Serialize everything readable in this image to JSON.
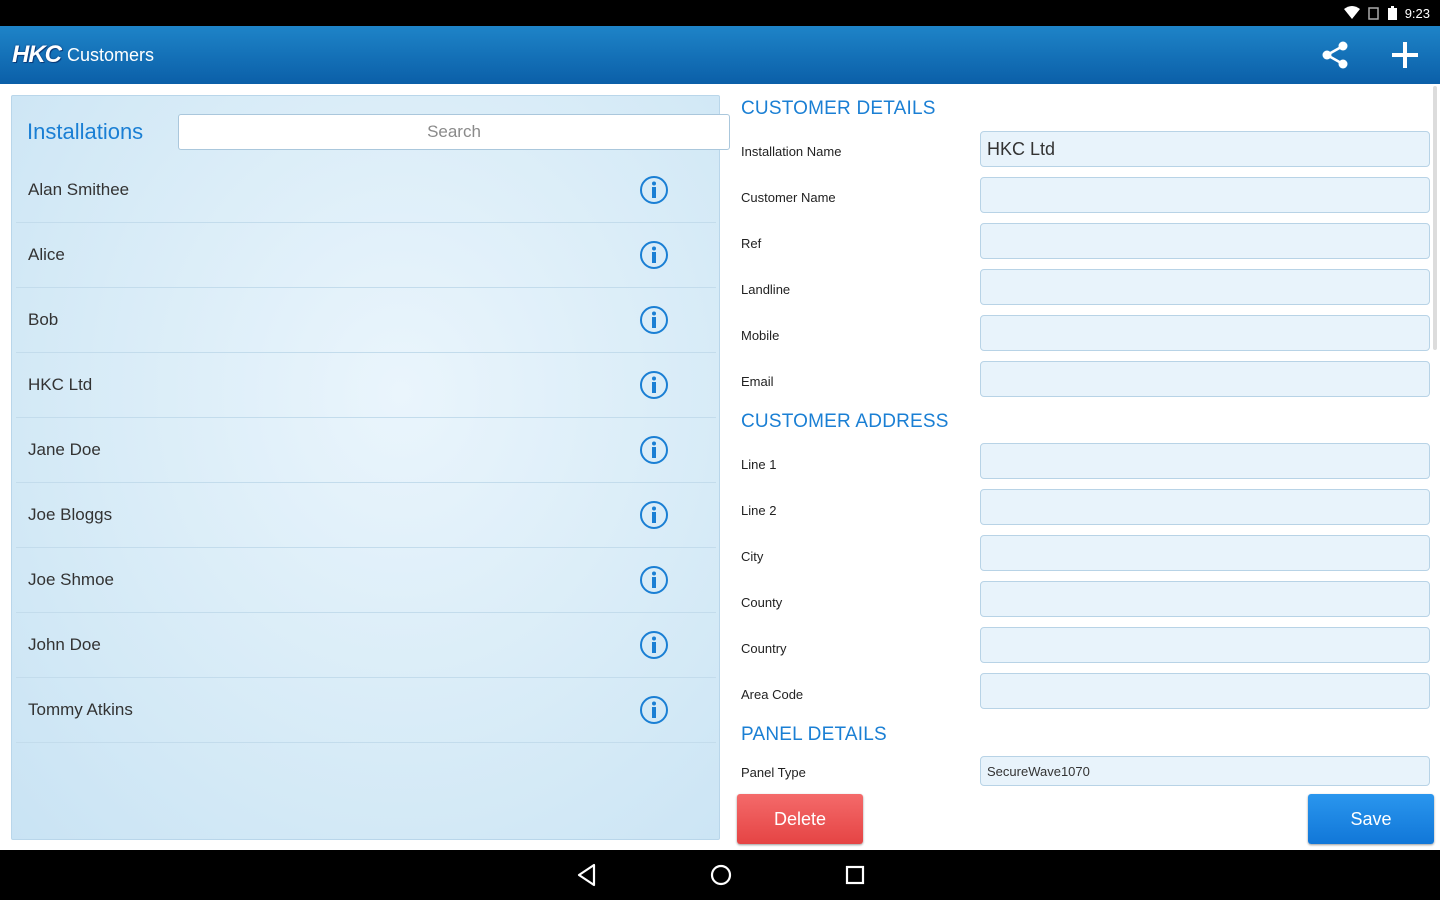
{
  "status": {
    "time": "9:23"
  },
  "app": {
    "logo": "HKC",
    "title": "Customers"
  },
  "installations": {
    "title": "Installations",
    "search_placeholder": "Search",
    "items": [
      {
        "name": "Alan Smithee"
      },
      {
        "name": "Alice"
      },
      {
        "name": "Bob"
      },
      {
        "name": "HKC Ltd"
      },
      {
        "name": "Jane Doe"
      },
      {
        "name": "Joe Bloggs"
      },
      {
        "name": "Joe Shmoe"
      },
      {
        "name": "John Doe"
      },
      {
        "name": "Tommy Atkins"
      }
    ]
  },
  "customer_details": {
    "title": "CUSTOMER DETAILS",
    "installation_name": {
      "label": "Installation Name",
      "value": "HKC Ltd"
    },
    "customer_name": {
      "label": "Customer Name",
      "value": ""
    },
    "ref": {
      "label": "Ref",
      "value": ""
    },
    "landline": {
      "label": "Landline",
      "value": ""
    },
    "mobile": {
      "label": "Mobile",
      "value": ""
    },
    "email": {
      "label": "Email",
      "value": ""
    }
  },
  "customer_address": {
    "title": "CUSTOMER ADDRESS",
    "line1": {
      "label": "Line 1",
      "value": ""
    },
    "line2": {
      "label": "Line 2",
      "value": ""
    },
    "city": {
      "label": "City",
      "value": ""
    },
    "county": {
      "label": "County",
      "value": ""
    },
    "country": {
      "label": "Country",
      "value": ""
    },
    "area_code": {
      "label": "Area Code",
      "value": ""
    }
  },
  "panel_details": {
    "title": "PANEL DETAILS",
    "panel_type": {
      "label": "Panel Type",
      "value": "SecureWave1070"
    }
  },
  "actions": {
    "delete_label": "Delete",
    "save_label": "Save"
  },
  "colors": {
    "accent": "#1a7fd4",
    "appbar": "#0b5fa8",
    "delete": "#e54444",
    "save": "#1177d8"
  }
}
